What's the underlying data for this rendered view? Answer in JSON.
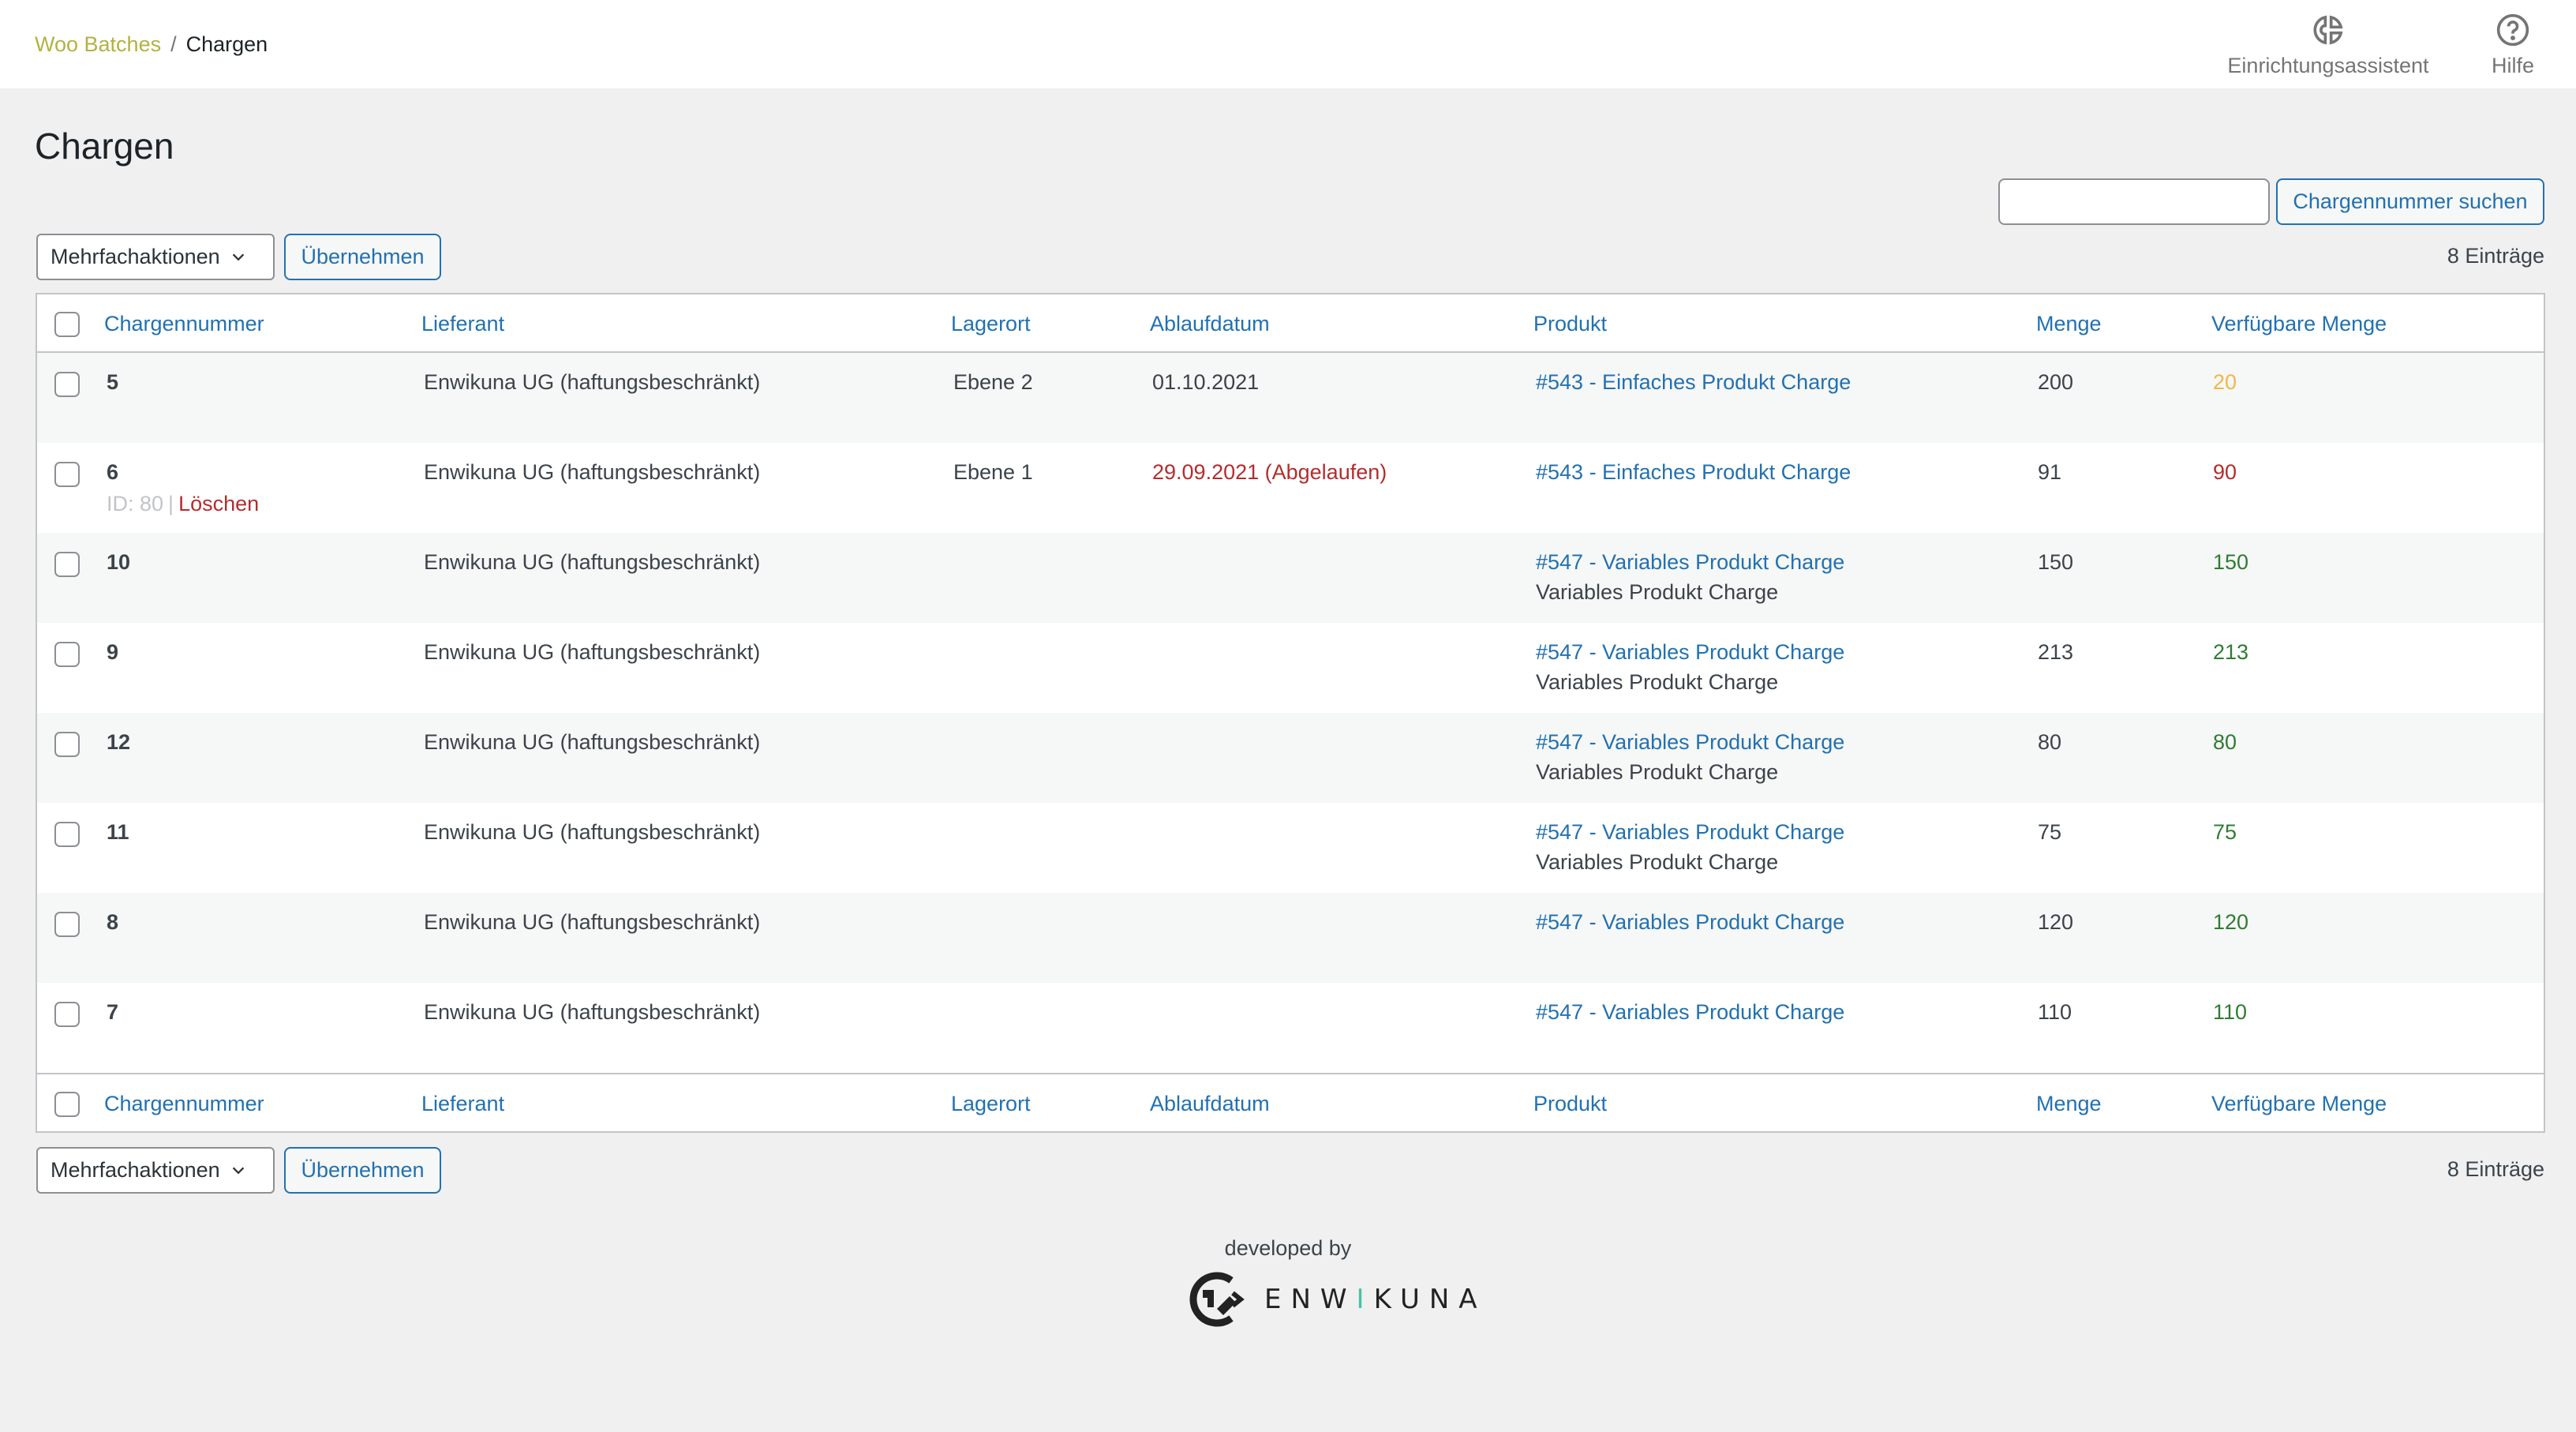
{
  "header": {
    "breadcrumb": {
      "parent": "Woo Batches",
      "separator": "/",
      "current": "Chargen"
    },
    "actions": [
      {
        "label": "Einrichtungsassistent",
        "icon": "setup-wizard-icon"
      },
      {
        "label": "Hilfe",
        "icon": "help-circle-icon"
      }
    ]
  },
  "page": {
    "title": "Chargen"
  },
  "search": {
    "value": "",
    "placeholder": "",
    "button_label": "Chargennummer suchen"
  },
  "bulk_actions": {
    "selected": "Mehrfachaktionen",
    "apply_label": "Übernehmen"
  },
  "count_label": "8 Einträge",
  "table": {
    "columns": [
      "Chargennummer",
      "Lieferant",
      "Lagerort",
      "Ablaufdatum",
      "Produkt",
      "Menge",
      "Verfügbare Menge"
    ],
    "rows": [
      {
        "number": "5",
        "supplier": "Enwikuna UG (haftungsbeschränkt)",
        "location": "Ebene 2",
        "expiry": "01.10.2021",
        "expired": false,
        "product": "#543 - Einfaches Produkt Charge",
        "product_sub": "",
        "quantity": "200",
        "available": "20",
        "available_status": "low"
      },
      {
        "number": "6",
        "supplier": "Enwikuna UG (haftungsbeschränkt)",
        "location": "Ebene 1",
        "expiry": "29.09.2021 (Abgelaufen)",
        "expired": true,
        "product": "#543 - Einfaches Produkt Charge",
        "product_sub": "",
        "quantity": "91",
        "available": "90",
        "available_status": "expired",
        "row_actions": {
          "id_label": "ID: 80",
          "separator": "|",
          "delete_label": "Löschen"
        }
      },
      {
        "number": "10",
        "supplier": "Enwikuna UG (haftungsbeschränkt)",
        "location": "",
        "expiry": "",
        "expired": false,
        "product": "#547 - Variables Produkt Charge",
        "product_sub": "Variables Produkt Charge",
        "quantity": "150",
        "available": "150",
        "available_status": "ok"
      },
      {
        "number": "9",
        "supplier": "Enwikuna UG (haftungsbeschränkt)",
        "location": "",
        "expiry": "",
        "expired": false,
        "product": "#547 - Variables Produkt Charge",
        "product_sub": "Variables Produkt Charge",
        "quantity": "213",
        "available": "213",
        "available_status": "ok"
      },
      {
        "number": "12",
        "supplier": "Enwikuna UG (haftungsbeschränkt)",
        "location": "",
        "expiry": "",
        "expired": false,
        "product": "#547 - Variables Produkt Charge",
        "product_sub": "Variables Produkt Charge",
        "quantity": "80",
        "available": "80",
        "available_status": "ok"
      },
      {
        "number": "11",
        "supplier": "Enwikuna UG (haftungsbeschränkt)",
        "location": "",
        "expiry": "",
        "expired": false,
        "product": "#547 - Variables Produkt Charge",
        "product_sub": "Variables Produkt Charge",
        "quantity": "75",
        "available": "75",
        "available_status": "ok"
      },
      {
        "number": "8",
        "supplier": "Enwikuna UG (haftungsbeschränkt)",
        "location": "",
        "expiry": "",
        "expired": false,
        "product": "#547 - Variables Produkt Charge",
        "product_sub": "",
        "quantity": "120",
        "available": "120",
        "available_status": "ok"
      },
      {
        "number": "7",
        "supplier": "Enwikuna UG (haftungsbeschränkt)",
        "location": "",
        "expiry": "",
        "expired": false,
        "product": "#547 - Variables Produkt Charge",
        "product_sub": "",
        "quantity": "110",
        "available": "110",
        "available_status": "ok"
      }
    ]
  },
  "status_colors": {
    "low": "#f0b849",
    "expired": "#b32d2e",
    "ok": "#2e7d32",
    "link": "#2271b1",
    "brand_breadcrumb": "#b2b244",
    "logo_accent": "#4bc0a8"
  },
  "footer": {
    "developed_by": "developed by",
    "logo_text_before": "ENW",
    "logo_text_accent": "I",
    "logo_text_after": "KUNA"
  }
}
